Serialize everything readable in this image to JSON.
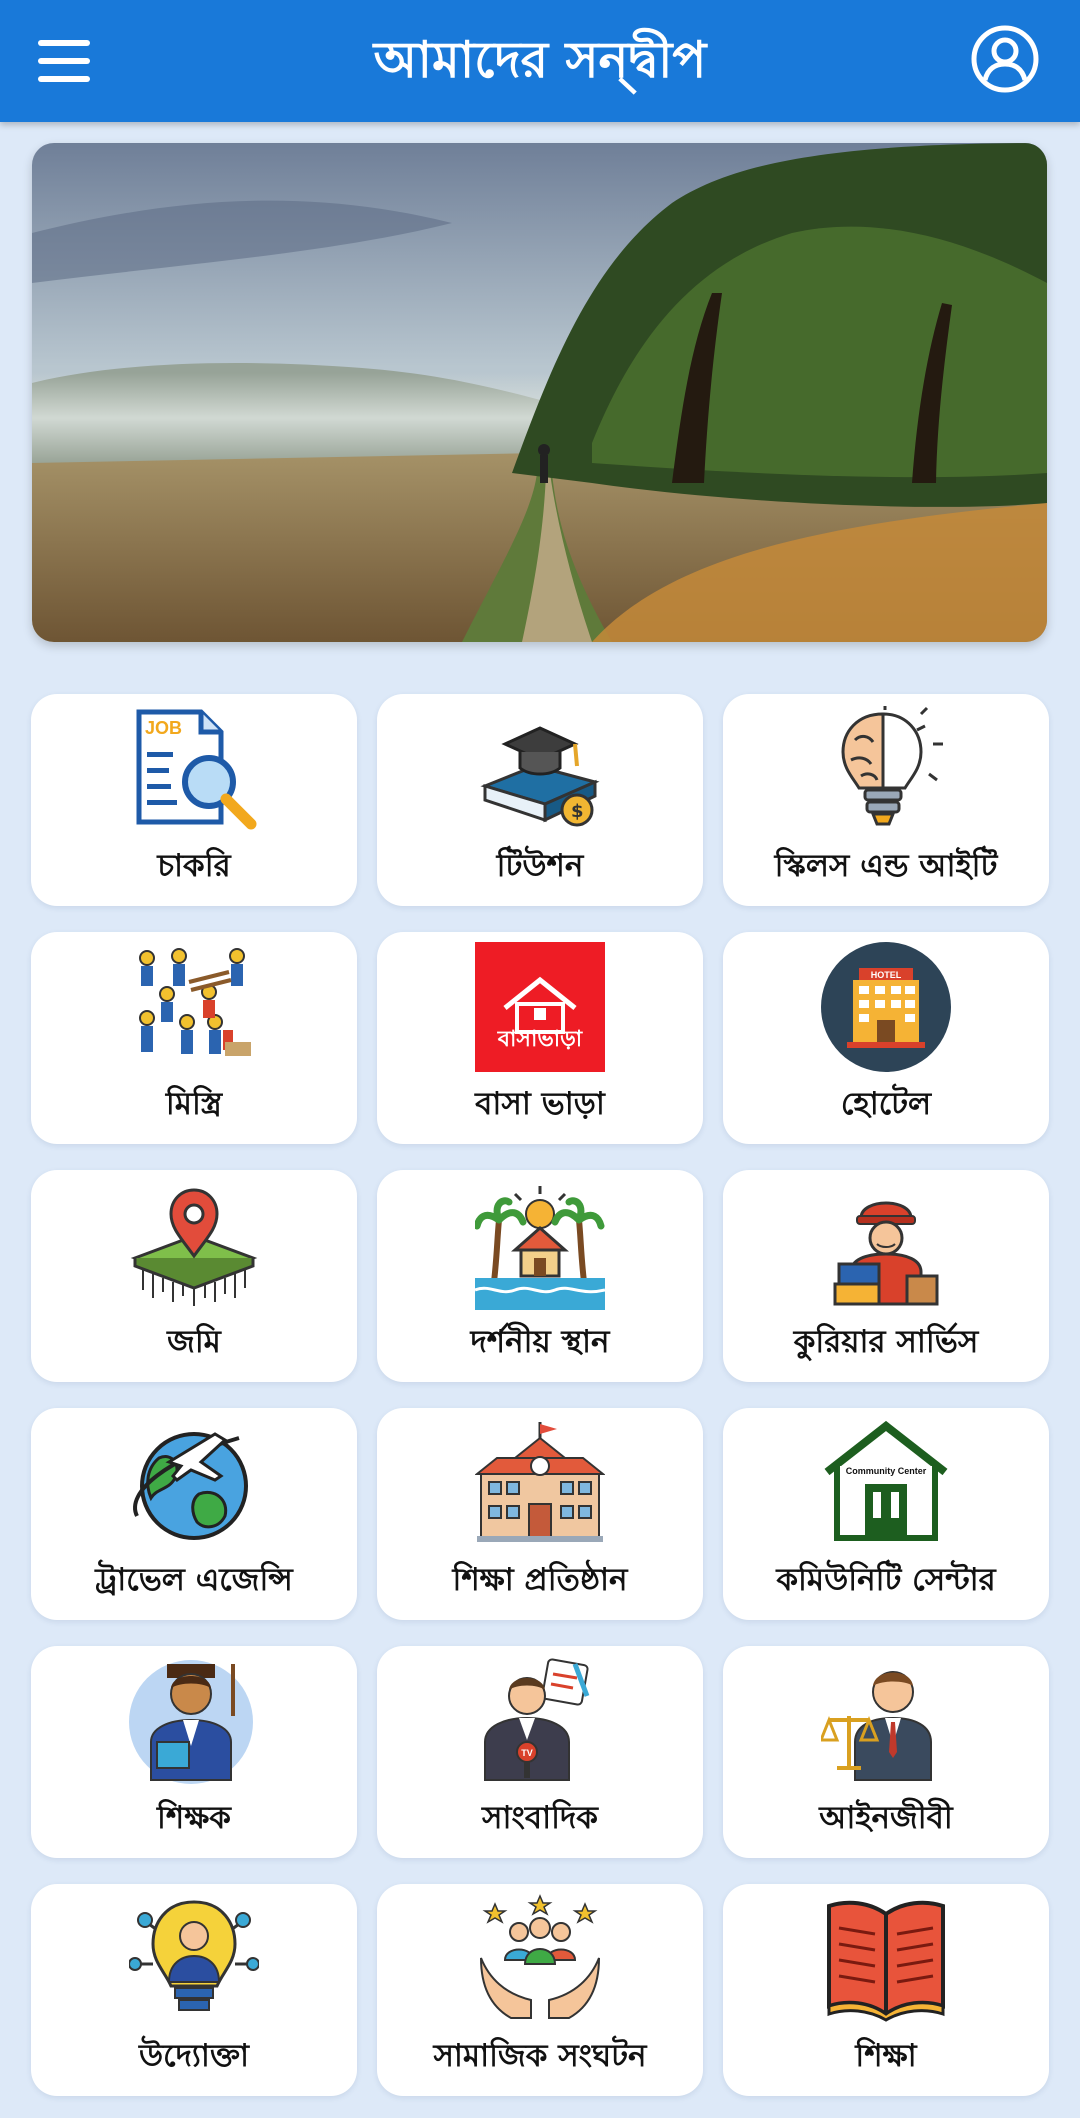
{
  "header": {
    "title": "আমাদের সন্দ্বীপ",
    "menu_icon": "hamburger-menu-icon",
    "profile_icon": "user-profile-icon",
    "bar_color": "#1979d9"
  },
  "banner": {
    "description_icon": "landscape-photo"
  },
  "categories": [
    {
      "label": "চাকরি",
      "icon": "job-search-icon"
    },
    {
      "label": "টিউশন",
      "icon": "graduation-books-icon"
    },
    {
      "label": "স্কিলস এন্ড আইটি",
      "icon": "brain-bulb-icon"
    },
    {
      "label": "মিস্ত্রি",
      "icon": "construction-workers-icon"
    },
    {
      "label": "বাসা ভাড়া",
      "icon": "house-rent-icon",
      "icon_text": "বাসাভাড়া"
    },
    {
      "label": "হোটেল",
      "icon": "hotel-building-icon",
      "icon_text": "HOTEL"
    },
    {
      "label": "জমি",
      "icon": "land-location-pin-icon"
    },
    {
      "label": "দর্শনীয় স্থান",
      "icon": "beach-resort-icon"
    },
    {
      "label": "কুরিয়ার সার্ভিস",
      "icon": "courier-delivery-icon"
    },
    {
      "label": "ট্রাভেল এজেন্সি",
      "icon": "globe-airplane-icon"
    },
    {
      "label": "শিক্ষা প্রতিষ্ঠান",
      "icon": "school-building-icon"
    },
    {
      "label": "কমিউনিটি সেন্টার",
      "icon": "community-center-icon",
      "icon_text": "Community Center"
    },
    {
      "label": "শিক্ষক",
      "icon": "teacher-icon"
    },
    {
      "label": "সাংবাদিক",
      "icon": "journalist-icon",
      "icon_text": "TV"
    },
    {
      "label": "আইনজীবী",
      "icon": "lawyer-scales-icon"
    },
    {
      "label": "উদ্যোক্তা",
      "icon": "entrepreneur-bulb-icon"
    },
    {
      "label": "সামাজিক সংঘটন",
      "icon": "social-organization-hands-icon"
    },
    {
      "label": "শিক্ষা",
      "icon": "open-book-icon"
    }
  ]
}
